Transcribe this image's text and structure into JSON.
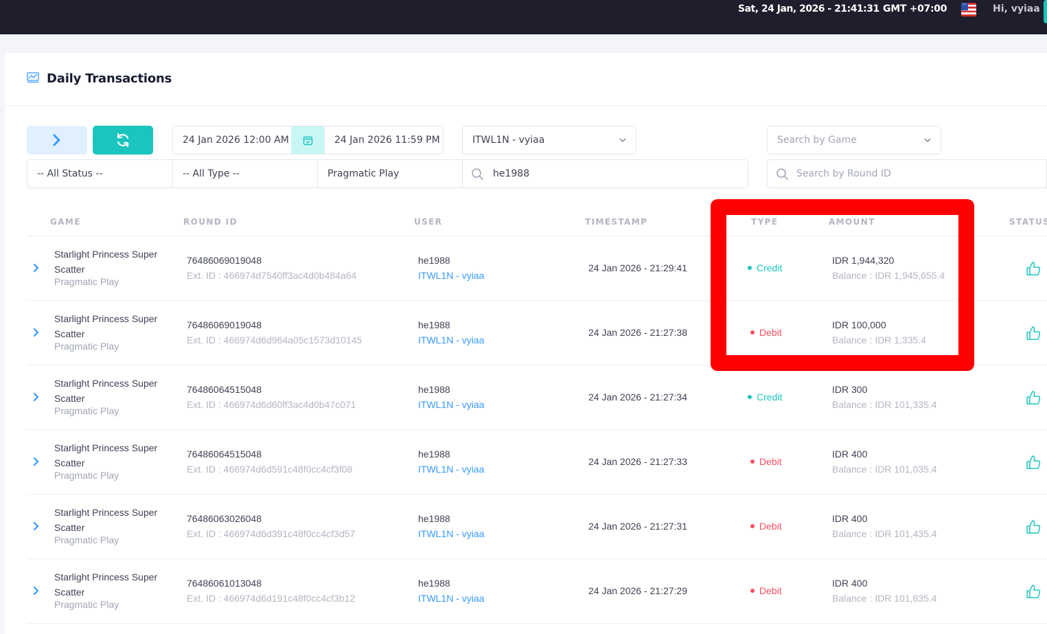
{
  "topbar": {
    "datetime": "Sat, 24 Jan, 2026 - 21:41:31",
    "timezone": "GMT +07:00",
    "greeting": "Hi, vyiaa"
  },
  "page": {
    "title": "Daily Transactions"
  },
  "filters": {
    "date_from": "24 Jan 2026 12:00 AM",
    "date_to": "24 Jan 2026 11:59 PM",
    "agent": "ITWL1N - vyiaa",
    "game_placeholder": "Search by Game",
    "status": "-- All Status --",
    "type": "-- All Type --",
    "provider": "Pragmatic Play",
    "user_search": "he1988",
    "round_placeholder": "Search by Round ID"
  },
  "table": {
    "headers": {
      "game": "GAME",
      "round_id": "ROUND ID",
      "user": "USER",
      "timestamp": "TIMESTAMP",
      "type": "TYPE",
      "amount": "AMOUNT",
      "status": "STATUS"
    },
    "rows": [
      {
        "game_line1": "Starlight Princess Super",
        "game_line2": "Scatter",
        "provider": "Pragmatic Play",
        "round_id": "76486069019048",
        "ext_id": "Ext. ID : 466974d7540ff3ac4d0b484a64",
        "user": "he1988",
        "agent": "ITWL1N - vyiaa",
        "timestamp": "24 Jan 2026 - 21:29:41",
        "type": "Credit",
        "amount": "IDR 1,944,320",
        "balance": "Balance : IDR 1,945,655.4"
      },
      {
        "game_line1": "Starlight Princess Super",
        "game_line2": "Scatter",
        "provider": "Pragmatic Play",
        "round_id": "76486069019048",
        "ext_id": "Ext. ID : 466974d6d964a05c1573d10145",
        "user": "he1988",
        "agent": "ITWL1N - vyiaa",
        "timestamp": "24 Jan 2026 - 21:27:38",
        "type": "Debit",
        "amount": "IDR 100,000",
        "balance": "Balance : IDR 1,335.4"
      },
      {
        "game_line1": "Starlight Princess Super",
        "game_line2": "Scatter",
        "provider": "Pragmatic Play",
        "round_id": "76486064515048",
        "ext_id": "Ext. ID : 466974d6d60ff3ac4d0b47c071",
        "user": "he1988",
        "agent": "ITWL1N - vyiaa",
        "timestamp": "24 Jan 2026 - 21:27:34",
        "type": "Credit",
        "amount": "IDR 300",
        "balance": "Balance : IDR 101,335.4"
      },
      {
        "game_line1": "Starlight Princess Super",
        "game_line2": "Scatter",
        "provider": "Pragmatic Play",
        "round_id": "76486064515048",
        "ext_id": "Ext. ID : 466974d6d591c48f0cc4cf3f08",
        "user": "he1988",
        "agent": "ITWL1N - vyiaa",
        "timestamp": "24 Jan 2026 - 21:27:33",
        "type": "Debit",
        "amount": "IDR 400",
        "balance": "Balance : IDR 101,035.4"
      },
      {
        "game_line1": "Starlight Princess Super",
        "game_line2": "Scatter",
        "provider": "Pragmatic Play",
        "round_id": "76486063026048",
        "ext_id": "Ext. ID : 466974d6d391c48f0cc4cf3d57",
        "user": "he1988",
        "agent": "ITWL1N - vyiaa",
        "timestamp": "24 Jan 2026 - 21:27:31",
        "type": "Debit",
        "amount": "IDR 400",
        "balance": "Balance : IDR 101,435.4"
      },
      {
        "game_line1": "Starlight Princess Super",
        "game_line2": "Scatter",
        "provider": "Pragmatic Play",
        "round_id": "76486061013048",
        "ext_id": "Ext. ID : 466974d6d191c48f0cc4cf3b12",
        "user": "he1988",
        "agent": "ITWL1N - vyiaa",
        "timestamp": "24 Jan 2026 - 21:27:29",
        "type": "Debit",
        "amount": "IDR 400",
        "balance": "Balance : IDR 101,835.4"
      }
    ]
  },
  "icons": {
    "expand": "chevron-right-icon",
    "refresh": "refresh-icon",
    "calendar": "calendar-icon",
    "search": "search-icon",
    "status": "thumbs-up-icon",
    "flag": "us-flag-icon"
  },
  "colors": {
    "credit": "#1bc5bd",
    "debit": "#f64e60",
    "link": "#3699ff",
    "highlight": "#ff0000"
  }
}
